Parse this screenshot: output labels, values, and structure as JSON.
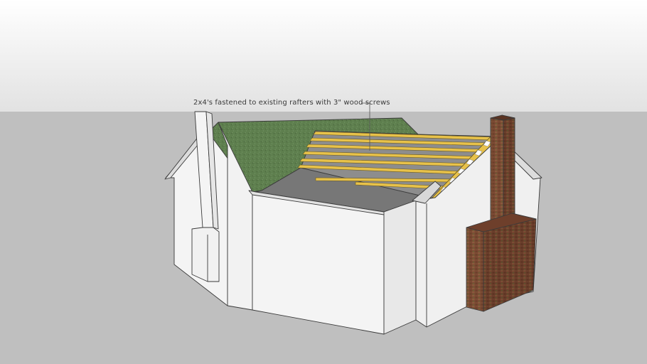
{
  "annotation": {
    "text": "2x4's fastened to existing rafters with 3\" wood screws"
  },
  "colors": {
    "sky_top": "#ffffff",
    "sky_bottom": "#e4e4e4",
    "ground": "#bfbfbf",
    "wall": "#f4f4f4",
    "wall_shade": "#e6e6e6",
    "shingles": "#5e7f4e",
    "flat_roof": "#777777",
    "lumber": "#e8c24a",
    "brick": "#7a4a33",
    "edge": "#3a3a3a"
  }
}
